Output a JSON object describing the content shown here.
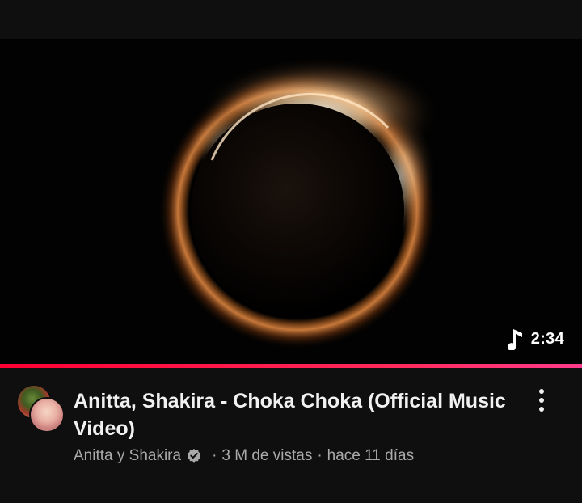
{
  "video": {
    "duration": "2:34",
    "duration_icon": "music-note-icon",
    "watched_progress": 1.0,
    "title": "Anitta, Shakira - Choka Choka (Official Music Video)",
    "channel": "Anitta y Shakira",
    "views": "3 M de vistas",
    "age": "hace 11 días",
    "separator": "·",
    "verified_icon": "verified-badge-icon",
    "more_icon": "more-vertical-icon"
  },
  "colors": {
    "background": "#0f0f0f",
    "progress_red": "#ff0033",
    "progress_pink": "#ff3b8b",
    "meta_text": "#aaaaaa",
    "title_text": "#f1f1f1"
  }
}
